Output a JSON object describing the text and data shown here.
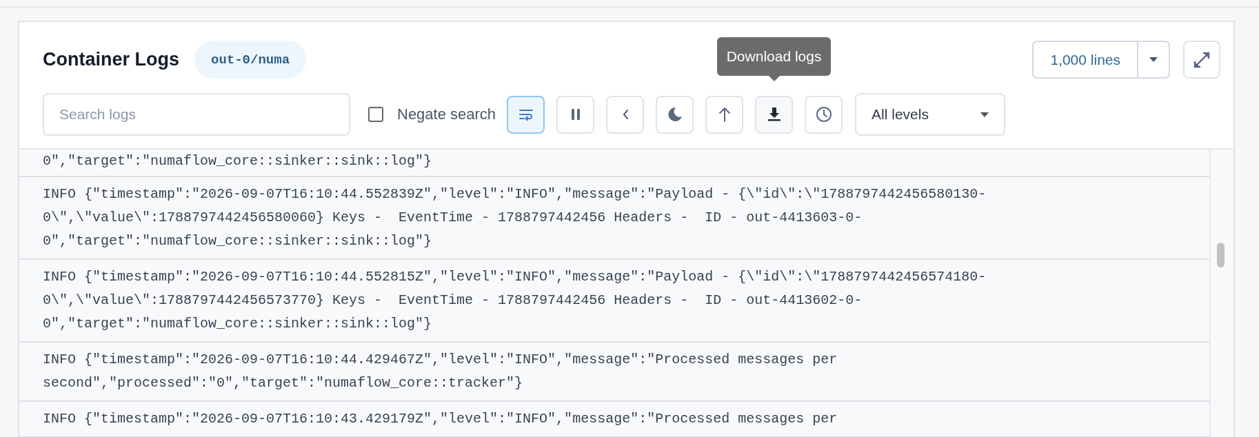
{
  "panel": {
    "title": "Container Logs",
    "pod_badge": "out-0/numa",
    "line_count": {
      "label": "1,000 lines"
    },
    "search": {
      "placeholder": "Search logs"
    },
    "negate_search": {
      "label": "Negate search",
      "checked": false
    },
    "toolbar_buttons": [
      {
        "kind": "wrap",
        "selected": true,
        "hovered": false
      },
      {
        "kind": "pause",
        "selected": false,
        "hovered": false
      },
      {
        "kind": "back",
        "selected": false,
        "hovered": false
      },
      {
        "kind": "theme",
        "selected": false,
        "hovered": false
      },
      {
        "kind": "top",
        "selected": false,
        "hovered": false
      },
      {
        "kind": "download",
        "selected": false,
        "hovered": true
      },
      {
        "kind": "time",
        "selected": false,
        "hovered": false
      }
    ],
    "tooltip": "Download logs",
    "level_filter": {
      "value": "All levels"
    }
  },
  "logs": [
    {
      "lines": [
        "0\",\"target\":\"numaflow_core::sinker::sink::log\"}"
      ]
    },
    {
      "lines": [
        "INFO {\"timestamp\":\"2026-09-07T16:10:44.552839Z\",\"level\":\"INFO\",\"message\":\"Payload - {\\\"id\\\":\\\"1788797442456580130-",
        "0\\\",\\\"value\\\":1788797442456580060} Keys -  EventTime - 1788797442456 Headers -  ID - out-4413603-0-",
        "0\",\"target\":\"numaflow_core::sinker::sink::log\"}"
      ]
    },
    {
      "lines": [
        "INFO {\"timestamp\":\"2026-09-07T16:10:44.552815Z\",\"level\":\"INFO\",\"message\":\"Payload - {\\\"id\\\":\\\"1788797442456574180-",
        "0\\\",\\\"value\\\":1788797442456573770} Keys -  EventTime - 1788797442456 Headers -  ID - out-4413602-0-",
        "0\",\"target\":\"numaflow_core::sinker::sink::log\"}"
      ]
    },
    {
      "lines": [
        "INFO {\"timestamp\":\"2026-09-07T16:10:44.429467Z\",\"level\":\"INFO\",\"message\":\"Processed messages per",
        "second\",\"processed\":\"0\",\"target\":\"numaflow_core::tracker\"}"
      ]
    },
    {
      "lines": [
        "INFO {\"timestamp\":\"2026-09-07T16:10:43.429179Z\",\"level\":\"INFO\",\"message\":\"Processed messages per"
      ]
    }
  ]
}
